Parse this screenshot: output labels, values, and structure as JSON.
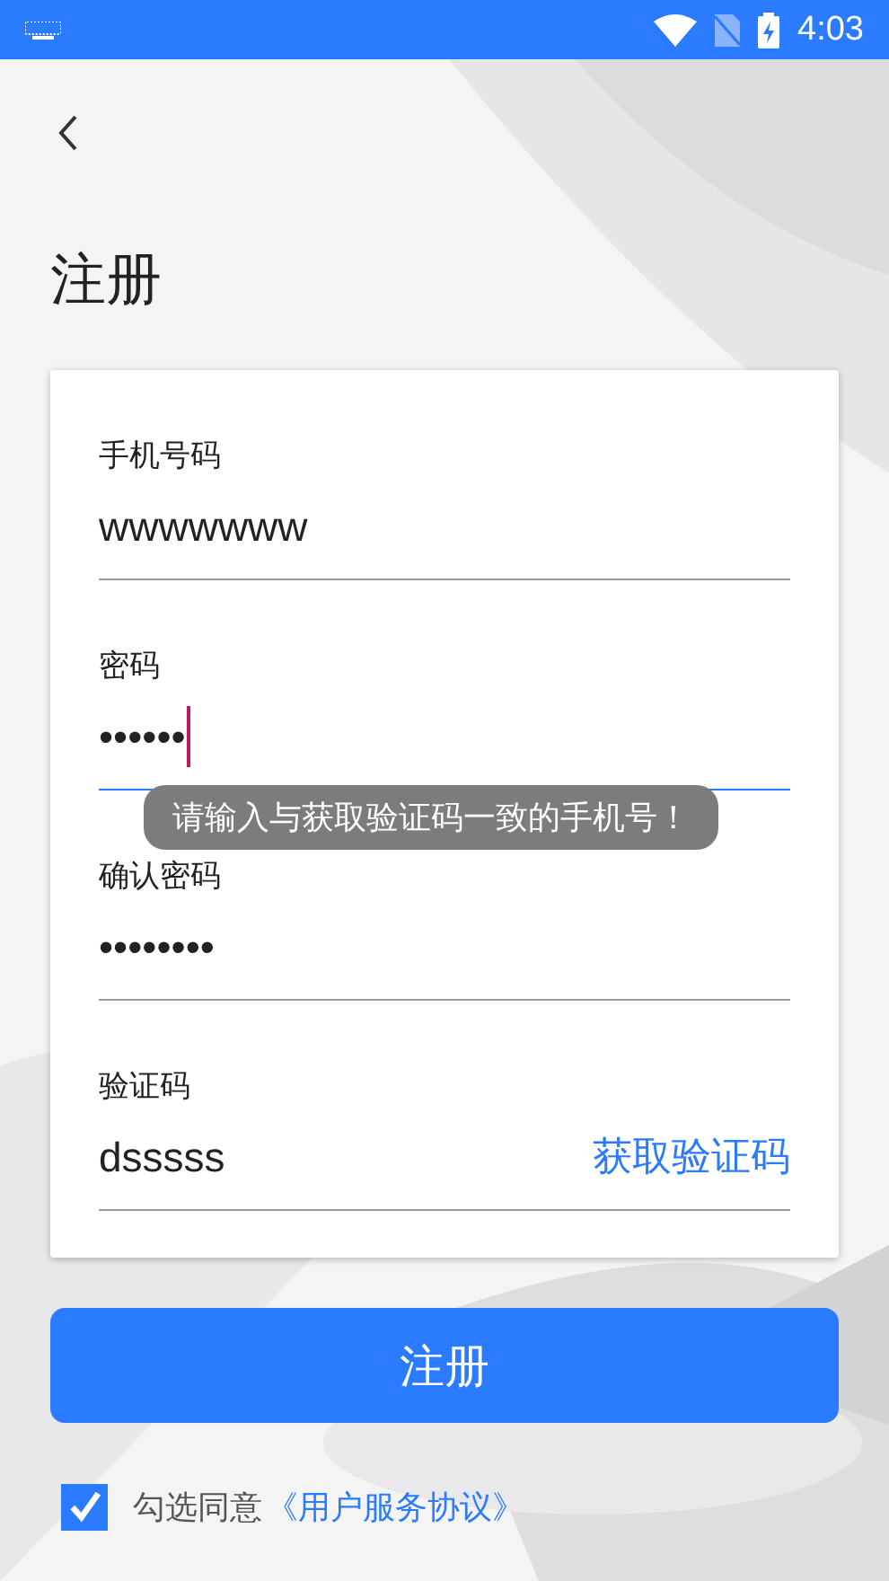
{
  "status_bar": {
    "time": "4:03"
  },
  "title": "注册",
  "fields": [
    {
      "label": "手机号码",
      "value": "wwwwwww",
      "focused": false
    },
    {
      "label": "密码",
      "value": "••••••",
      "focused": true
    },
    {
      "label": "确认密码",
      "value": "••••••••",
      "focused": false
    },
    {
      "label": "验证码",
      "value": "dsssss",
      "focused": false,
      "action": "获取验证码"
    }
  ],
  "toast": "请输入与获取验证码一致的手机号！",
  "submit": "注册",
  "agreement": {
    "checked": true,
    "text": "勾选同意",
    "link": "《用户服务协议》"
  }
}
